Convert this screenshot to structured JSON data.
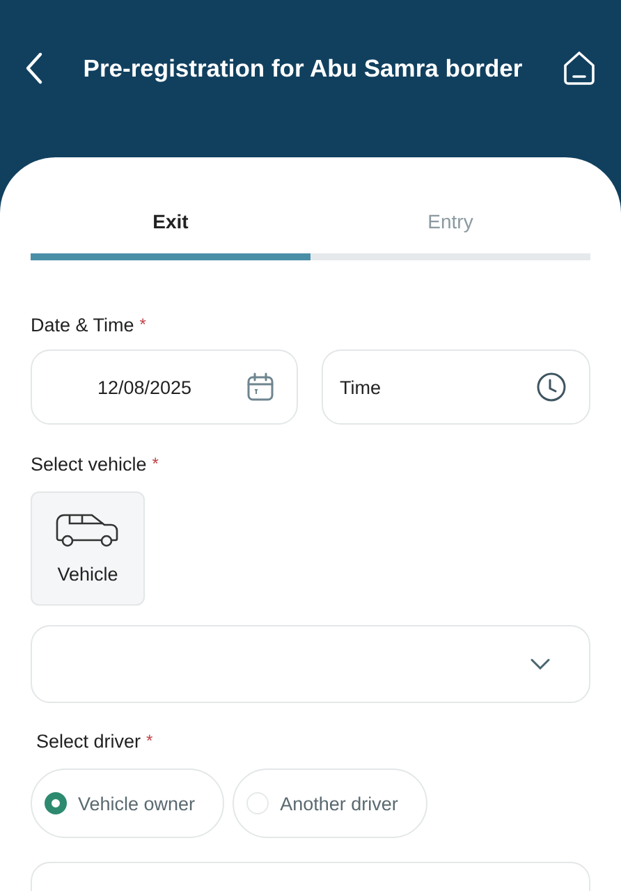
{
  "header": {
    "title": "Pre-registration for Abu Samra border"
  },
  "tabs": [
    {
      "label": "Exit",
      "selected": true
    },
    {
      "label": "Entry",
      "selected": false
    }
  ],
  "date_time": {
    "label": "Date & Time",
    "required_mark": "*",
    "date_value": "12/08/2025",
    "time_placeholder": "Time"
  },
  "vehicle": {
    "label": "Select vehicle",
    "required_mark": "*",
    "tile_label": "Vehicle"
  },
  "driver": {
    "label": "Select driver",
    "required_mark": "*",
    "options": [
      {
        "label": "Vehicle owner",
        "selected": true
      },
      {
        "label": "Another driver",
        "selected": false
      }
    ]
  }
}
